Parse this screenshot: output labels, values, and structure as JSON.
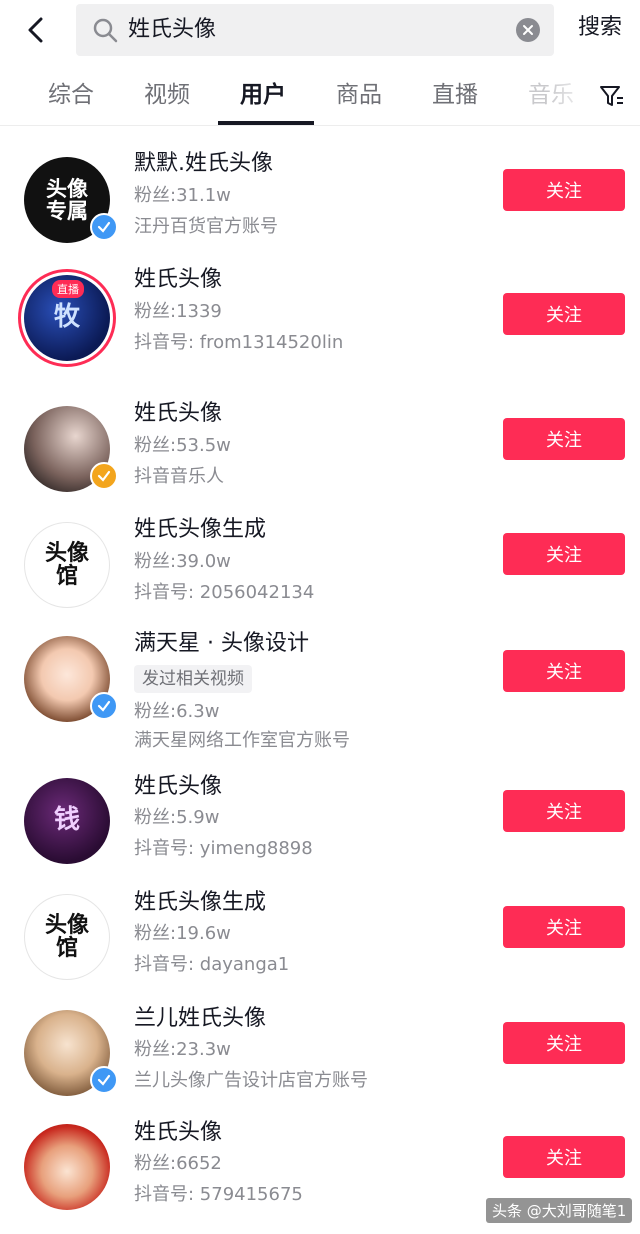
{
  "search": {
    "query": "姓氏头像",
    "submit_label": "搜索",
    "back_icon": "chevron-left-icon",
    "search_icon": "search-icon",
    "clear_icon": "close-icon"
  },
  "tabs": [
    {
      "label": "综合"
    },
    {
      "label": "视频"
    },
    {
      "label": "用户"
    },
    {
      "label": "商品"
    },
    {
      "label": "直播"
    },
    {
      "label": "音乐"
    }
  ],
  "active_tab": "用户",
  "filter_icon": "filter-icon",
  "users": [
    {
      "name": "默默.姓氏头像",
      "fans": "粉丝:31.1w",
      "desc": "汪丹百货官方账号",
      "avatar_text": "头像专属",
      "verified": "blue",
      "follow_label": "关注"
    },
    {
      "name": "姓氏头像",
      "fans": "粉丝:1339",
      "desc": "抖音号: from1314520lin",
      "avatar_text": "牧",
      "live_label": "直播",
      "follow_label": "关注"
    },
    {
      "name": "姓氏头像",
      "fans": "粉丝:53.5w",
      "desc": "抖音音乐人",
      "verified": "yellow",
      "follow_label": "关注"
    },
    {
      "name": "姓氏头像生成",
      "fans": "粉丝:39.0w",
      "desc": "抖音号: 2056042134",
      "avatar_text": "头像馆",
      "follow_label": "关注"
    },
    {
      "name": "满天星 · 头像设计",
      "tag": "发过相关视频",
      "fans": "粉丝:6.3w",
      "desc": "满天星网络工作室官方账号",
      "verified": "blue",
      "follow_label": "关注"
    },
    {
      "name": "姓氏头像",
      "fans": "粉丝:5.9w",
      "desc": "抖音号: yimeng8898",
      "avatar_text": "钱",
      "follow_label": "关注"
    },
    {
      "name": "姓氏头像生成",
      "fans": "粉丝:19.6w",
      "desc": "抖音号: dayanga1",
      "avatar_text": "头像馆",
      "follow_label": "关注"
    },
    {
      "name": "兰儿姓氏头像",
      "fans": "粉丝:23.3w",
      "desc": "兰儿头像广告设计店官方账号",
      "verified": "blue",
      "follow_label": "关注"
    },
    {
      "name": "姓氏头像",
      "fans": "粉丝:6652",
      "desc": "抖音号: 579415675",
      "follow_label": "关注"
    }
  ],
  "watermark": "头条 @大刘哥随笔1",
  "colors": {
    "accent": "#fe2c55",
    "verify_blue": "#3f98f5",
    "verify_yellow": "#f3a51d",
    "text": "#161823",
    "muted": "#8a8b91"
  }
}
